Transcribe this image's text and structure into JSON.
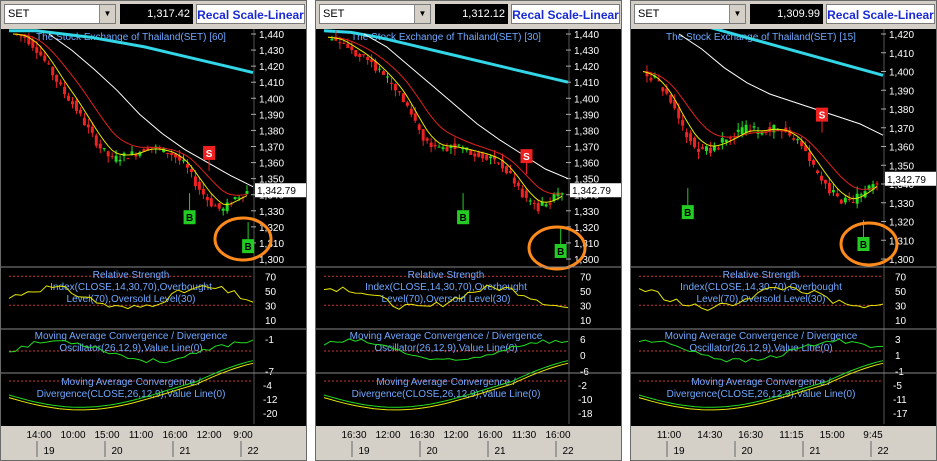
{
  "panels": [
    {
      "symbol": "SET",
      "price": "1,317.42",
      "recal_label": "Recal Scale-Linear",
      "main_title": "The Stock Exchange of Thailand(SET) [60]",
      "y_ticks": [
        "1,440",
        "1,430",
        "1,420",
        "1,410",
        "1,400",
        "1,390",
        "1,380",
        "1,370",
        "1,360",
        "1,350",
        "1,340",
        "1,330",
        "1,320",
        "1,310",
        "1,300"
      ],
      "last_price_label": "1,342.79",
      "rsi_title": [
        "Relative Strength",
        "Index(CLOSE,14,30,70),Overbought",
        "Level(70),Oversold Level(30)"
      ],
      "rsi_ticks": [
        "70",
        "50",
        "30",
        "10"
      ],
      "macd1_title": [
        "Moving Average Convergence / Divergence",
        "Oscillator(26,12,9),Value Line(0)"
      ],
      "macd1_ticks": [
        "-1",
        "-7"
      ],
      "macd2_title": [
        "Moving Average Convergence /",
        "Divergence(CLOSE,26,12,9),Value Line(0)"
      ],
      "macd2_ticks": [
        "-4",
        "-12",
        "-20"
      ],
      "x_times": [
        "14:00",
        "10:00",
        "15:00",
        "11:00",
        "16:00",
        "12:00",
        "9:00"
      ],
      "x_days": [
        "19",
        "20",
        "21",
        "22"
      ],
      "signals": [
        "S",
        "B",
        "B"
      ]
    },
    {
      "symbol": "SET",
      "price": "1,312.12",
      "recal_label": "Recal Scale-Linear",
      "main_title": "The Stock Exchange of Thailand(SET) [30]",
      "y_ticks": [
        "1,440",
        "1,430",
        "1,420",
        "1,410",
        "1,400",
        "1,390",
        "1,380",
        "1,370",
        "1,360",
        "1,350",
        "1,340",
        "1,330",
        "1,320",
        "1,310",
        "1,300"
      ],
      "last_price_label": "1,342.79",
      "rsi_title": [
        "Relative Strength",
        "Index(CLOSE,14,30,70),Overbought",
        "Level(70),Oversold Level(30)"
      ],
      "rsi_ticks": [
        "70",
        "50",
        "30",
        "10"
      ],
      "macd1_title": [
        "Moving Average Convergence / Divergence",
        "Oscillator(26,12,9),Value Line(0)"
      ],
      "macd1_ticks": [
        "6",
        "0",
        "-6"
      ],
      "macd2_title": [
        "Moving Average Convergence /",
        "Divergence(CLOSE,26,12,9),Value Line(0)"
      ],
      "macd2_ticks": [
        "-2",
        "-10",
        "-18"
      ],
      "x_times": [
        "16:30",
        "12:00",
        "16:30",
        "12:00",
        "16:00",
        "11:30",
        "16:00"
      ],
      "x_days": [
        "19",
        "20",
        "21",
        "22"
      ],
      "signals": [
        "S",
        "B",
        "B"
      ]
    },
    {
      "symbol": "SET",
      "price": "1,309.99",
      "recal_label": "Recal Scale-Linear",
      "main_title": "The Stock Exchange of Thailand(SET) [15]",
      "y_ticks": [
        "1,420",
        "1,410",
        "1,400",
        "1,390",
        "1,380",
        "1,370",
        "1,360",
        "1,350",
        "1,340",
        "1,330",
        "1,320",
        "1,310",
        "1,300"
      ],
      "last_price_label": "1,342.79",
      "rsi_title": [
        "Relative Strength",
        "Index(CLOSE,14,30,70),Overbought",
        "Level(70),Oversold Level(30)"
      ],
      "rsi_ticks": [
        "70",
        "50",
        "30",
        "10"
      ],
      "macd1_title": [
        "Moving Average Convergence / Divergence",
        "Oscillator(26,12,9),Value Line(0)"
      ],
      "macd1_ticks": [
        "3",
        "1",
        "-1"
      ],
      "macd2_title": [
        "Moving Average Convergence /",
        "Divergence(CLOSE,26,12,9),Value Line(0)"
      ],
      "macd2_ticks": [
        "-5",
        "-11",
        "-17"
      ],
      "x_times": [
        "11:00",
        "14:30",
        "16:30",
        "11:15",
        "15:00",
        "9:45"
      ],
      "x_days": [
        "19",
        "20",
        "21",
        "22"
      ],
      "signals": [
        "S",
        "B",
        "B"
      ]
    }
  ],
  "colors": {
    "background": "#000000",
    "axis_text": "#ffffff",
    "title_text": "#6fa8ff",
    "candle_up": "#22dd22",
    "candle_down": "#ee2222",
    "ma_fast": "#e8e800",
    "ma_mid": "#e02020",
    "ma_slow": "#ffffff",
    "ma_long": "#33d6e6",
    "highlight": "#ff8a1c",
    "sell": "#ee2020",
    "buy": "#22cc22"
  }
}
